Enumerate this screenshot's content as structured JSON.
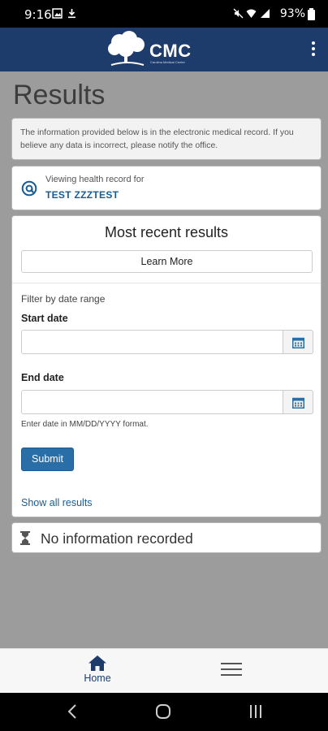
{
  "status_bar": {
    "time": "9:16",
    "battery": "93%"
  },
  "app_bar": {
    "logo_text": "CMC",
    "logo_subtitle": "Carolina Medical Center"
  },
  "page": {
    "title": "Results"
  },
  "notice": {
    "text": "The information provided below is in the electronic medical record. If you believe any data is incorrect, please notify the office."
  },
  "patient": {
    "label": "Viewing health record for",
    "name": "TEST ZZZTEST"
  },
  "results_card": {
    "heading": "Most recent results",
    "learn_more": "Learn More",
    "filter_label": "Filter by date range",
    "start_label": "Start date",
    "start_value": "",
    "end_label": "End date",
    "end_value": "",
    "hint": "Enter date in MM/DD/YYYY format.",
    "submit": "Submit",
    "show_all": "Show all results"
  },
  "no_info": {
    "text": "No information recorded"
  },
  "bottom_nav": {
    "home": "Home"
  },
  "colors": {
    "brand": "#1d3c6b",
    "link": "#1a5c8f",
    "button": "#2a6ea8"
  }
}
